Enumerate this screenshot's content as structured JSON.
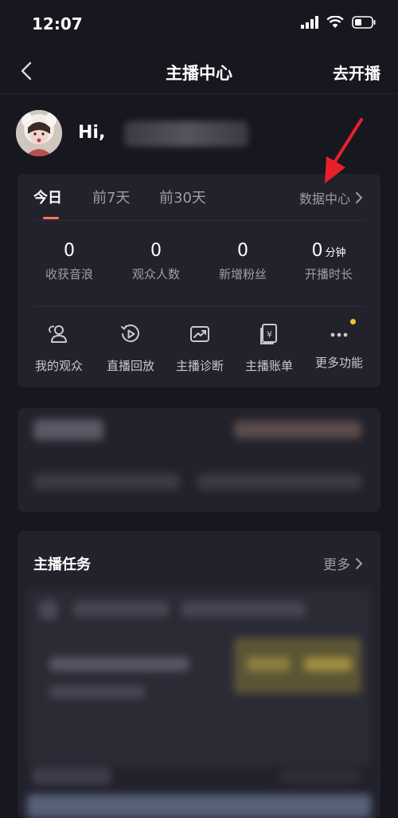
{
  "status_bar": {
    "time": "12:07"
  },
  "nav": {
    "title": "主播中心",
    "action": "去开播"
  },
  "profile": {
    "greeting": "Hi,"
  },
  "stats_card": {
    "tabs": [
      {
        "label": "今日",
        "active": true
      },
      {
        "label": "前7天",
        "active": false
      },
      {
        "label": "前30天",
        "active": false
      }
    ],
    "data_center_link": "数据中心",
    "stats": [
      {
        "value": "0",
        "unit": "",
        "label": "收获音浪"
      },
      {
        "value": "0",
        "unit": "",
        "label": "观众人数"
      },
      {
        "value": "0",
        "unit": "",
        "label": "新增粉丝"
      },
      {
        "value": "0",
        "unit": "分钟",
        "label": "开播时长"
      }
    ],
    "tools": [
      {
        "label": "我的观众",
        "icon": "audience-icon"
      },
      {
        "label": "直播回放",
        "icon": "replay-icon"
      },
      {
        "label": "主播诊断",
        "icon": "diagnosis-icon"
      },
      {
        "label": "主播账单",
        "icon": "bill-icon"
      },
      {
        "label": "更多功能",
        "icon": "more-icon"
      }
    ]
  },
  "tasks_card": {
    "title": "主播任务",
    "more_link": "更多"
  },
  "colors": {
    "background": "#17171f",
    "card": "#22222c",
    "accent_underline": "#f2795a",
    "annotation_arrow": "#e8202a",
    "badge_dot": "#f5c52d",
    "muted_text": "#9e9ea6"
  }
}
